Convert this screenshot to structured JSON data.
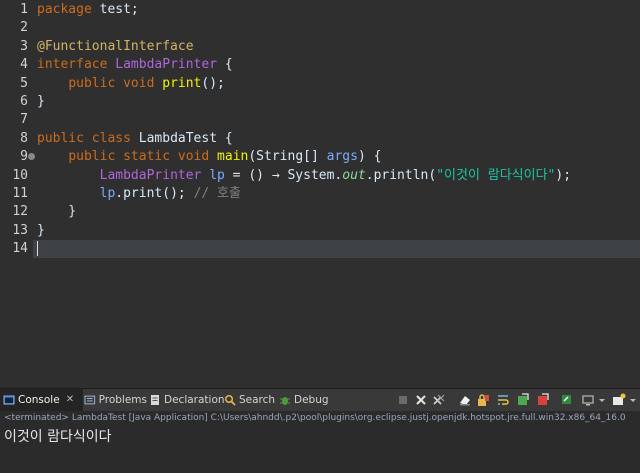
{
  "editor": {
    "line_numbers": [
      "1",
      "2",
      "3",
      "4",
      "5",
      "6",
      "7",
      "8",
      "9",
      "10",
      "11",
      "12",
      "13",
      "14"
    ],
    "lines": [
      [
        {
          "t": "package",
          "c": "kw"
        },
        {
          "t": " test;",
          "c": "txt"
        }
      ],
      [],
      [
        {
          "t": "@FunctionalInterface",
          "c": "ann"
        }
      ],
      [
        {
          "t": "interface",
          "c": "kw"
        },
        {
          "t": " ",
          "c": "txt"
        },
        {
          "t": "LambdaPrinter",
          "c": "iface"
        },
        {
          "t": " {",
          "c": "txt"
        }
      ],
      [
        {
          "t": "    ",
          "c": "txt"
        },
        {
          "t": "public",
          "c": "kw"
        },
        {
          "t": " ",
          "c": "txt"
        },
        {
          "t": "void",
          "c": "kw"
        },
        {
          "t": " ",
          "c": "txt"
        },
        {
          "t": "print",
          "c": "var"
        },
        {
          "t": "();",
          "c": "txt"
        }
      ],
      [
        {
          "t": "}",
          "c": "txt"
        }
      ],
      [],
      [
        {
          "t": "public",
          "c": "kw"
        },
        {
          "t": " ",
          "c": "txt"
        },
        {
          "t": "class",
          "c": "kw"
        },
        {
          "t": " LambdaTest {",
          "c": "txt"
        }
      ],
      [
        {
          "t": "    ",
          "c": "txt"
        },
        {
          "t": "public",
          "c": "kw"
        },
        {
          "t": " ",
          "c": "txt"
        },
        {
          "t": "static",
          "c": "kw"
        },
        {
          "t": " ",
          "c": "txt"
        },
        {
          "t": "void",
          "c": "kw"
        },
        {
          "t": " ",
          "c": "txt"
        },
        {
          "t": "main",
          "c": "var"
        },
        {
          "t": "(String[] ",
          "c": "txt"
        },
        {
          "t": "args",
          "c": "param"
        },
        {
          "t": ") {",
          "c": "txt"
        }
      ],
      [
        {
          "t": "        ",
          "c": "txt"
        },
        {
          "t": "LambdaPrinter",
          "c": "iface"
        },
        {
          "t": " ",
          "c": "txt"
        },
        {
          "t": "lp",
          "c": "param"
        },
        {
          "t": " = () → System.",
          "c": "txt"
        },
        {
          "t": "out",
          "c": "fld"
        },
        {
          "t": ".println(",
          "c": "txt"
        },
        {
          "t": "\"이것이 람다식이다\"",
          "c": "str"
        },
        {
          "t": ");",
          "c": "txt"
        }
      ],
      [
        {
          "t": "        ",
          "c": "txt"
        },
        {
          "t": "lp",
          "c": "param"
        },
        {
          "t": ".print(); ",
          "c": "txt"
        },
        {
          "t": "// 호출",
          "c": "cmt"
        }
      ],
      [
        {
          "t": "    }",
          "c": "txt"
        }
      ],
      [
        {
          "t": "}",
          "c": "txt"
        }
      ],
      []
    ]
  },
  "console": {
    "tabs": [
      {
        "label": "Console",
        "icon": "console-icon",
        "active": true
      },
      {
        "label": "Problems",
        "icon": "problems-icon",
        "active": false
      },
      {
        "label": "Declaration",
        "icon": "declaration-icon",
        "active": false
      },
      {
        "label": "Search",
        "icon": "search-icon",
        "active": false
      },
      {
        "label": "Debug",
        "icon": "debug-icon",
        "active": false
      }
    ],
    "close_glyph": "✕",
    "status": "<terminated> LambdaTest [Java Application] C:\\Users\\ahndd\\.p2\\pool\\plugins\\org.eclipse.justj.openjdk.hotspot.jre.full.win32.x86_64_16.0",
    "output": "이것이 람다식이다"
  },
  "colors": {
    "editor_bg": "#2f2f2f",
    "current_line_bg": "#3e4246",
    "keyword": "#cc6c1d",
    "string": "#17c6a3",
    "comment": "#808080"
  }
}
